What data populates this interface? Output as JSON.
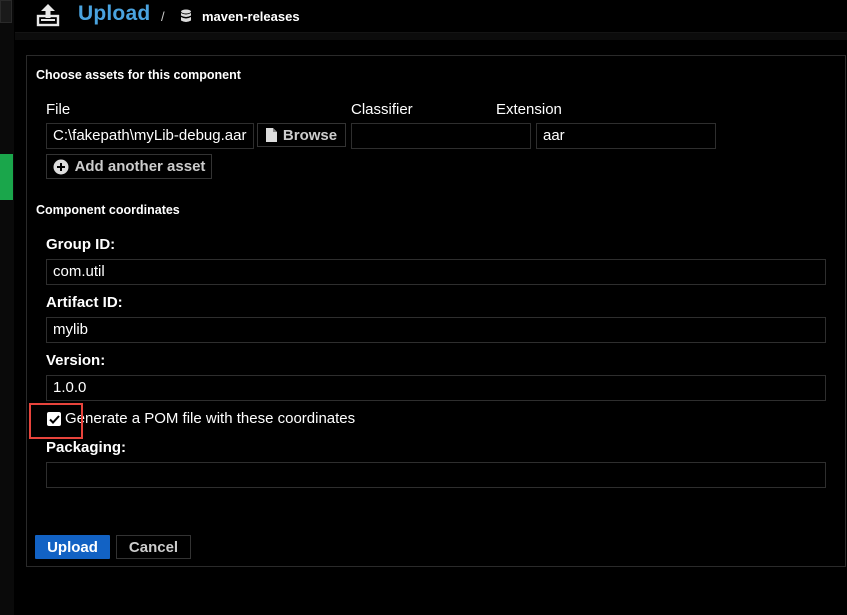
{
  "header": {
    "title": "Upload",
    "separator": "/",
    "repository": "maven-releases",
    "icons": {
      "upload": "upload-icon",
      "repository": "database-icon"
    }
  },
  "assets": {
    "section_title": "Choose assets for this component",
    "columns": {
      "file": "File",
      "classifier": "Classifier",
      "extension": "Extension"
    },
    "file_value": "C:\\fakepath\\myLib-debug.aar",
    "browse_label": "Browse",
    "classifier_value": "",
    "extension_value": "aar",
    "add_asset_label": "Add another asset"
  },
  "coordinates": {
    "section_title": "Component coordinates",
    "group_id_label": "Group ID:",
    "group_id_value": "com.util",
    "artifact_id_label": "Artifact ID:",
    "artifact_id_value": "mylib",
    "version_label": "Version:",
    "version_value": "1.0.0",
    "generate_pom_label": "Generate a POM file with these coordinates",
    "generate_pom_checked": true,
    "packaging_label": "Packaging:",
    "packaging_value": ""
  },
  "actions": {
    "upload_label": "Upload",
    "cancel_label": "Cancel"
  },
  "colors": {
    "accent": "#4aa3df",
    "primary_button": "#1262c4",
    "highlight": "#e8443c",
    "nav_indicator": "#1aa64b"
  }
}
